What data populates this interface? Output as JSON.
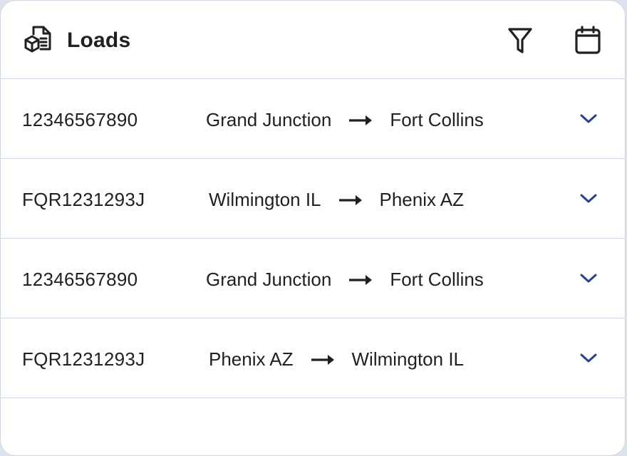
{
  "header": {
    "title": "Loads",
    "logo_icon": "document-package-icon",
    "filter_icon": "filter-icon",
    "calendar_icon": "calendar-icon"
  },
  "loads": [
    {
      "id": "12346567890",
      "origin": "Grand Junction",
      "destination": "Fort Collins"
    },
    {
      "id": "FQR1231293J",
      "origin": "Wilmington IL",
      "destination": "Phenix AZ"
    },
    {
      "id": "12346567890",
      "origin": "Grand Junction",
      "destination": "Fort Collins"
    },
    {
      "id": "FQR1231293J",
      "origin": "Phenix AZ",
      "destination": "Wilmington IL"
    }
  ],
  "colors": {
    "accent": "#2f3f8f",
    "border": "#cfd7e2",
    "text": "#1f1f24"
  }
}
